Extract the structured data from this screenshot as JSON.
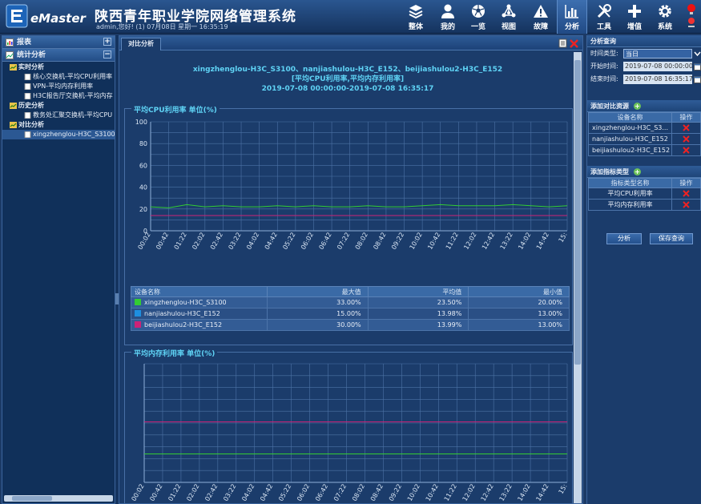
{
  "header": {
    "system_title": "陕西青年职业学院网络管理系统",
    "user_line": "admin,您好! (1) 07月08日 星期一 16:35:19",
    "logo_text": "eMaster",
    "nav": [
      {
        "label": "整体",
        "icon": "layers-icon"
      },
      {
        "label": "我的",
        "icon": "user-icon"
      },
      {
        "label": "一览",
        "icon": "soccer-ball-icon"
      },
      {
        "label": "视图",
        "icon": "topology-icon"
      },
      {
        "label": "故障",
        "icon": "warning-icon"
      },
      {
        "label": "分析",
        "icon": "bar-chart-icon",
        "active": true
      },
      {
        "label": "工具",
        "icon": "tools-icon"
      },
      {
        "label": "增值",
        "icon": "plus-icon"
      },
      {
        "label": "系统",
        "icon": "gear-icon"
      }
    ]
  },
  "left": {
    "sections": [
      {
        "label": "报表"
      },
      {
        "label": "统计分析"
      }
    ],
    "tree": [
      {
        "label": "实时分析",
        "level": 1
      },
      {
        "label": "核心交换机-平均CPU利用率",
        "level": 2
      },
      {
        "label": "VPN-平均内存利用率",
        "level": 2
      },
      {
        "label": "H3C报告厅交换机-平均内存",
        "level": 2
      },
      {
        "label": "历史分析",
        "level": 1
      },
      {
        "label": "教务处汇聚交换机-平均CPU",
        "level": 2
      },
      {
        "label": "对比分析",
        "level": 1
      },
      {
        "label": "xingzhenglou-H3C_S3100、",
        "level": 2,
        "selected": true
      }
    ]
  },
  "center": {
    "tab_label": "对比分析",
    "report_title": {
      "line1": "xingzhenglou-H3C_S3100、nanjiashulou-H3C_E152、beijiashulou2-H3C_E152",
      "line2": "[平均CPU利用率,平均内存利用率]",
      "line3": "2019-07-08 00:00:00-2019-07-08 16:35:17"
    },
    "cpu_section_label": "平均CPU利用率 单位(%)",
    "mem_section_label": "平均内存利用率 单位(%)",
    "stats_table": {
      "columns": [
        "设备名称",
        "最大值",
        "平均值",
        "最小值"
      ],
      "rows": [
        {
          "name": "xingzhenglou-H3C_S3100",
          "color": "#33cc33",
          "max": "33.00%",
          "avg": "23.50%",
          "min": "20.00%"
        },
        {
          "name": "nanjiashulou-H3C_E152",
          "color": "#1e8fe0",
          "max": "15.00%",
          "avg": "13.98%",
          "min": "13.00%"
        },
        {
          "name": "beijiashulou2-H3C_E152",
          "color": "#cc2277",
          "max": "30.00%",
          "avg": "13.99%",
          "min": "13.00%"
        }
      ]
    }
  },
  "chart_data": [
    {
      "type": "line",
      "title": "平均CPU利用率 单位(%)",
      "ylim": [
        0,
        100
      ],
      "yticks": [
        0,
        20,
        40,
        60,
        80,
        100
      ],
      "grid": true,
      "legend": "bottom",
      "x": [
        "00:02",
        "00:42",
        "01:22",
        "02:02",
        "02:42",
        "03:22",
        "04:02",
        "04:42",
        "05:22",
        "06:02",
        "06:42",
        "07:22",
        "08:02",
        "08:42",
        "09:22",
        "10:02",
        "10:42",
        "11:22",
        "12:02",
        "12:42",
        "13:22",
        "14:02",
        "14:42",
        "15:"
      ],
      "series": [
        {
          "name": "xingzhenglou-H3C_S3100",
          "color": "#33cc33",
          "values": [
            22,
            21,
            24,
            22,
            23,
            22,
            22,
            23,
            22,
            23,
            22,
            22,
            23,
            22,
            22,
            23,
            24,
            23,
            23,
            23,
            24,
            23,
            22,
            23
          ]
        },
        {
          "name": "nanjiashulou-H3C_E152",
          "color": "#1e8fe0",
          "values": [
            14,
            14,
            14,
            14,
            14,
            14,
            14,
            14,
            14,
            14,
            14,
            14,
            14,
            14,
            14,
            14,
            14,
            14,
            14,
            14,
            14,
            14,
            14,
            14
          ]
        },
        {
          "name": "beijiashulou2-H3C_E152",
          "color": "#cc2277",
          "values": [
            14,
            14,
            14,
            14,
            14,
            14,
            14,
            14,
            14,
            14,
            14,
            14,
            14,
            14,
            14,
            14,
            14,
            14,
            14,
            14,
            14,
            14,
            14,
            14
          ]
        }
      ]
    },
    {
      "type": "line",
      "title": "平均内存利用率 单位(%)",
      "ylim": [
        0,
        100
      ],
      "grid": true,
      "x": [
        "00:02",
        "00:42",
        "01:22",
        "02:02",
        "02:42",
        "03:22",
        "04:02",
        "04:42",
        "05:22",
        "06:02",
        "06:42",
        "07:22",
        "08:02",
        "08:42",
        "09:22",
        "10:02",
        "10:42",
        "11:22",
        "12:02",
        "12:42",
        "13:22",
        "14:02",
        "14:42",
        "15:"
      ],
      "series": [
        {
          "name": "xingzhenglou-H3C_S3100",
          "color": "#33cc33",
          "values": [
            24,
            24,
            24,
            24,
            24,
            24,
            24,
            24,
            24,
            24,
            24,
            24,
            24,
            24,
            24,
            24,
            24,
            24,
            24,
            24,
            24,
            24,
            24,
            24
          ]
        },
        {
          "name": "beijiashulou2-H3C_E152",
          "color": "#cc2277",
          "values": [
            51,
            51,
            51,
            51,
            51,
            51,
            51,
            51,
            51,
            51,
            51,
            51,
            51,
            51,
            51,
            51,
            51,
            51,
            51,
            51,
            51,
            51,
            51,
            51
          ]
        }
      ]
    }
  ],
  "right": {
    "query_header": "分析查询",
    "time_type_label": "时间类型:",
    "time_type_value": "当日",
    "start_label": "开始时间:",
    "start_value": "2019-07-08 00:00:00",
    "end_label": "结束时间:",
    "end_value": "2019-07-08 16:35:17",
    "compare_header": "添加对比资源",
    "compare_cols": [
      "设备名称",
      "操作"
    ],
    "compare_rows": [
      "xingzhenglou-H3C_S3...",
      "nanjiashulou-H3C_E152",
      "beijiashulou2-H3C_E152"
    ],
    "metric_header": "添加指标类型",
    "metric_cols": [
      "指标类型名称",
      "操作"
    ],
    "metric_rows": [
      "平均CPU利用率",
      "平均内存利用率"
    ],
    "analyze_btn": "分析",
    "save_btn": "保存查询"
  }
}
